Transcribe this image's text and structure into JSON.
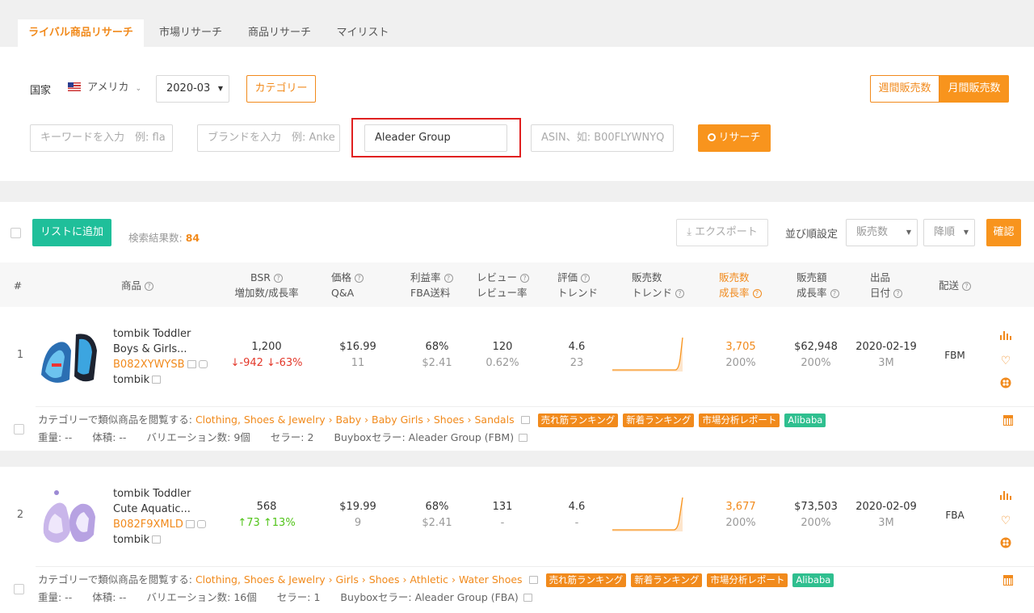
{
  "tabs": [
    "ライバル商品リサーチ",
    "市場リサーチ",
    "商品リサーチ",
    "マイリスト"
  ],
  "filters": {
    "country_label": "国家",
    "country_value": "アメリカ",
    "month_value": "2020-03",
    "category_button": "カテゴリー",
    "weekly_sales": "週間販売数",
    "monthly_sales": "月間販売数",
    "keyword_placeholder": "キーワードを入力　例: fla",
    "brand_placeholder": "ブランドを入力　例: Anke",
    "seller_value": "Aleader Group",
    "asin_placeholder": "ASIN、如: B00FLYWNYQ",
    "search_button": "リサーチ"
  },
  "toolbar": {
    "add_to_list": "リストに追加",
    "result_count_label": "検索結果数:",
    "result_count": "84",
    "export": "エクスポート",
    "sort_label": "並び順設定",
    "sort_field": "販売数",
    "sort_order": "降順",
    "confirm": "確認"
  },
  "columns": {
    "num": "#",
    "product": "商品",
    "bsr1": "BSR",
    "bsr2": "増加数/成長率",
    "price1": "価格",
    "price2": "Q&A",
    "profit1": "利益率",
    "profit2": "FBA送料",
    "review1": "レビュー",
    "review2": "レビュー率",
    "rating1": "評価",
    "rating2": "トレンド",
    "sales_trend1": "販売数",
    "sales_trend2": "トレンド",
    "sales_growth1": "販売数",
    "sales_growth2": "成長率",
    "revenue1": "販売額",
    "revenue2": "成長率",
    "listing1": "出品",
    "listing2": "日付",
    "shipping": "配送"
  },
  "rows": [
    {
      "index": "1",
      "title1": "tombik Toddler",
      "title2": "Boys & Girls...",
      "asin": "B082XYWYSB",
      "brand": "tombik",
      "bsr": "1,200",
      "bsr_change": "↓-942  ↓-63%",
      "price": "$16.99",
      "qa": "11",
      "profit": "68%",
      "fba": "$2.41",
      "reviews": "120",
      "review_rate": "0.62%",
      "rating": "4.6",
      "rating_trend": "23",
      "sales": "3,705",
      "sales_growth": "200%",
      "revenue": "$62,948",
      "revenue_growth": "200%",
      "date": "2020-02-19",
      "months": "3M",
      "shipping": "FBM",
      "category_prefix": "カテゴリーで類似商品を閲覧する:",
      "category_path": "Clothing, Shoes & Jewelry › Baby › Baby Girls › Shoes › Sandals",
      "tag1": "売れ筋ランキング",
      "tag2": "新着ランキング",
      "tag3": "市場分析レポート",
      "tag4": "Alibaba",
      "details": "重量: --　　体積: --　　バリエーション数: 9個　　セラー: 2",
      "buybox": "Buyboxセラー:  Aleader Group  (FBM)"
    },
    {
      "index": "2",
      "title1": "tombik Toddler",
      "title2": "Cute Aquatic...",
      "asin": "B082F9XMLD",
      "brand": "tombik",
      "bsr": "568",
      "bsr_change": "↑73  ↑13%",
      "price": "$19.99",
      "qa": "9",
      "profit": "68%",
      "fba": "$2.41",
      "reviews": "131",
      "review_rate": "-",
      "rating": "4.6",
      "rating_trend": "-",
      "sales": "3,677",
      "sales_growth": "200%",
      "revenue": "$73,503",
      "revenue_growth": "200%",
      "date": "2020-02-09",
      "months": "3M",
      "shipping": "FBA",
      "category_prefix": "カテゴリーで類似商品を閲覧する:",
      "category_path": "Clothing, Shoes & Jewelry › Girls › Shoes › Athletic › Water Shoes",
      "tag1": "売れ筋ランキング",
      "tag2": "新着ランキング",
      "tag3": "市場分析レポート",
      "tag4": "Alibaba",
      "details": "重量: --　　体積: --　　バリエーション数: 16個　　セラー: 1",
      "buybox": "Buyboxセラー:  Aleader Group  (FBA)"
    }
  ],
  "icons": [
    "us-flag-icon",
    "chevron-down-icon",
    "search-icon",
    "download-icon",
    "help-icon",
    "external-link-icon",
    "comment-icon",
    "bar-chart-icon",
    "heart-icon",
    "more-icon",
    "calculator-icon",
    "product-image"
  ],
  "colors": {
    "accent": "#f18a1c",
    "primary_green": "#1fbf9a",
    "highlight_box": "#e02020"
  }
}
